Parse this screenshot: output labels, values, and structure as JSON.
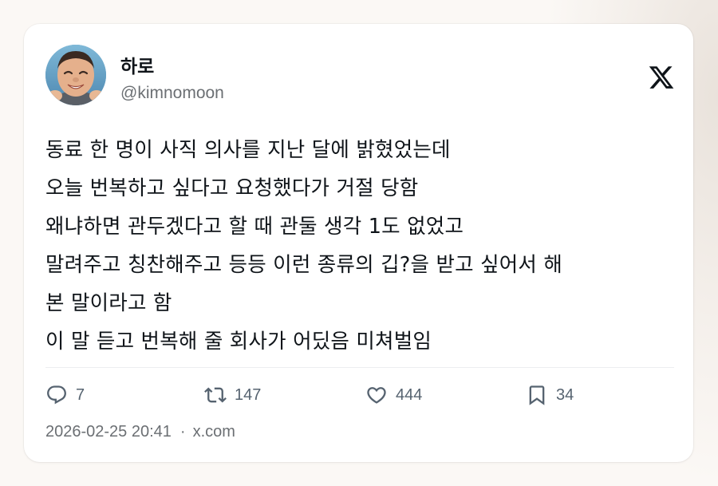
{
  "tweet": {
    "author": {
      "display_name": "하로",
      "handle": "@kimnomoon",
      "avatar": "avatar-photo"
    },
    "platform_icon": "x-logo-icon",
    "lines": [
      "동료 한 명이 사직 의사를 지난 달에 밝혔었는데",
      "오늘 번복하고 싶다고 요청했다가 거절 당함",
      "왜냐하면 관두겠다고 할 때 관둘 생각 1도 없었고",
      "말려주고 칭찬해주고 등등 이런 종류의 깁?을 받고 싶어서 해",
      "본 말이라고 함",
      "이 말 듣고 번복해 줄 회사가 어딨음 미쳐벌임"
    ],
    "actions": {
      "reply": {
        "icon": "reply-icon",
        "count": "7"
      },
      "retweet": {
        "icon": "retweet-icon",
        "count": "147"
      },
      "like": {
        "icon": "heart-icon",
        "count": "444"
      },
      "bookmark": {
        "icon": "bookmark-icon",
        "count": "34"
      }
    },
    "timestamp": "2026-02-25 20:41",
    "separator": "·",
    "source": "x.com"
  },
  "colors": {
    "background": "#fbf8f5",
    "card": "#ffffff",
    "text_primary": "#0f1419",
    "text_secondary": "#6b6f73",
    "icon": "#566370"
  }
}
